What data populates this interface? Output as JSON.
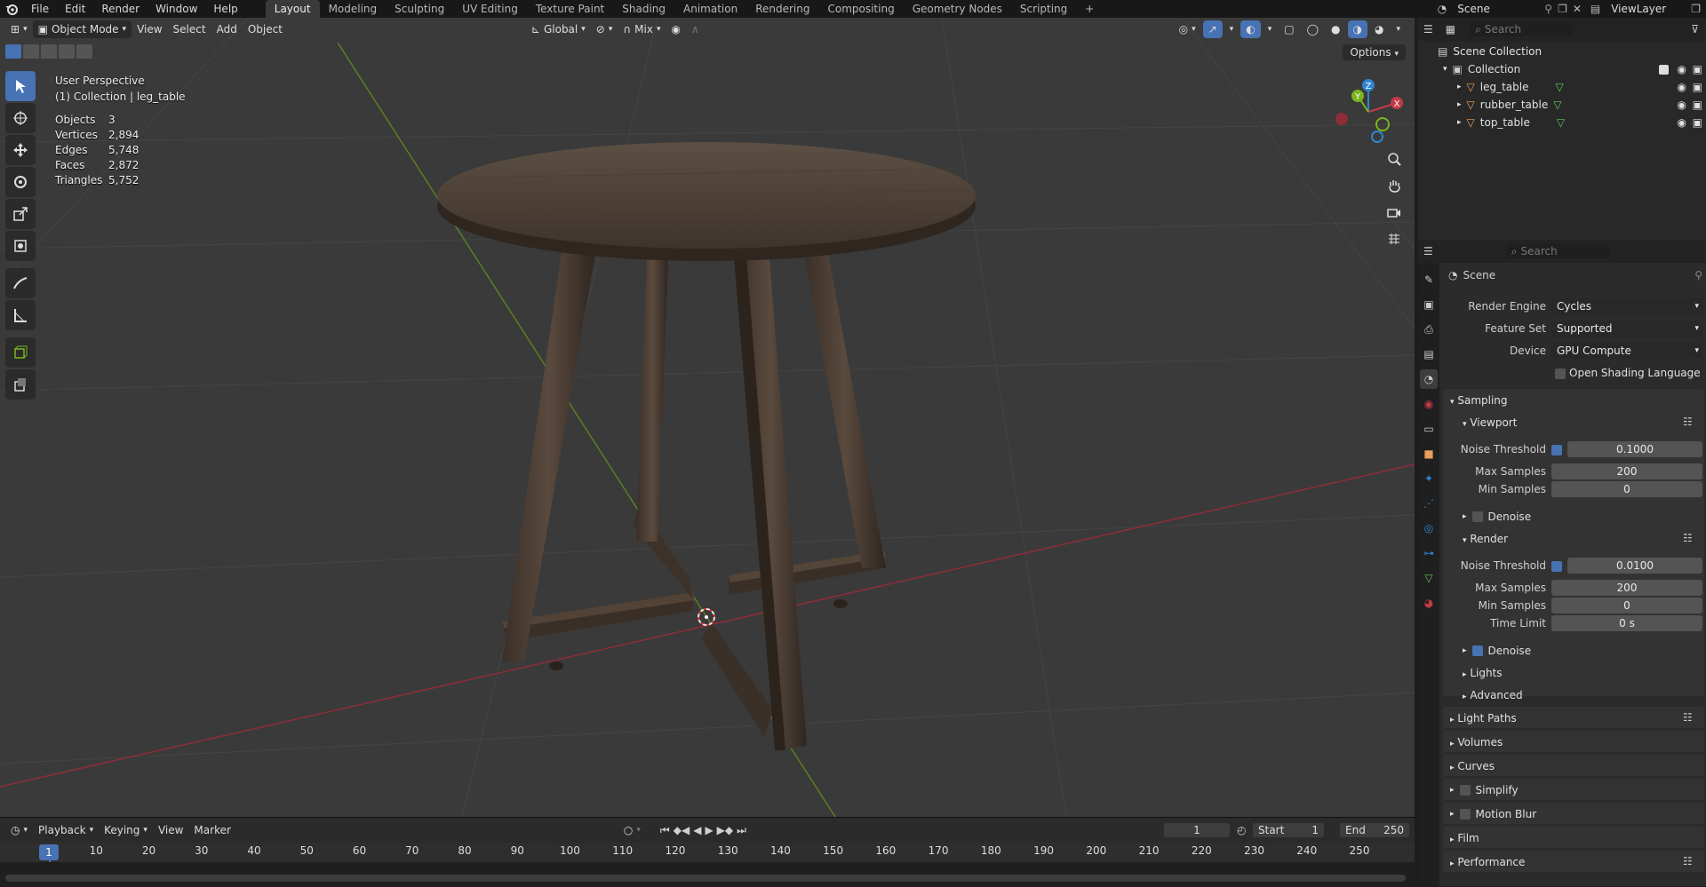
{
  "menu": {
    "items": [
      "File",
      "Edit",
      "Render",
      "Window",
      "Help"
    ]
  },
  "workspaces": [
    "Layout",
    "Modeling",
    "Sculpting",
    "UV Editing",
    "Texture Paint",
    "Shading",
    "Animation",
    "Rendering",
    "Compositing",
    "Geometry Nodes",
    "Scripting"
  ],
  "scene_name": "Scene",
  "view_layer": "ViewLayer",
  "viewport": {
    "mode": "Object Mode",
    "menus": [
      "View",
      "Select",
      "Add",
      "Object"
    ],
    "transform_orientation": "Global",
    "snap_mode": "Mix",
    "options_label": "Options",
    "perspective": "User Perspective",
    "active": "(1) Collection | leg_table",
    "stats": [
      {
        "label": "Objects",
        "value": "3"
      },
      {
        "label": "Vertices",
        "value": "2,894"
      },
      {
        "label": "Edges",
        "value": "5,748"
      },
      {
        "label": "Faces",
        "value": "2,872"
      },
      {
        "label": "Triangles",
        "value": "5,752"
      }
    ],
    "gizmo": {
      "z": "Z",
      "y": "Y",
      "x": "X"
    }
  },
  "timeline": {
    "menus": [
      "Playback",
      "Keying",
      "View",
      "Marker"
    ],
    "current_frame": "1",
    "start_label": "Start",
    "start": "1",
    "end_label": "End",
    "end": "250",
    "ticks": [
      "1",
      "10",
      "20",
      "30",
      "40",
      "50",
      "60",
      "70",
      "80",
      "90",
      "100",
      "110",
      "120",
      "130",
      "140",
      "150",
      "160",
      "170",
      "180",
      "190",
      "200",
      "210",
      "220",
      "230",
      "240",
      "250"
    ]
  },
  "outliner": {
    "search_placeholder": "Search",
    "scene_collection": "Scene Collection",
    "collection": "Collection",
    "objects": [
      "leg_table",
      "rubber_table",
      "top_table"
    ]
  },
  "properties": {
    "search_placeholder": "Search",
    "context": "Scene",
    "render_engine_label": "Render Engine",
    "render_engine": "Cycles",
    "feature_set_label": "Feature Set",
    "feature_set": "Supported",
    "device_label": "Device",
    "device": "GPU Compute",
    "osl_label": "Open Shading Language",
    "sampling": "Sampling",
    "viewport_label": "Viewport",
    "render_label": "Render",
    "noise_threshold_label": "Noise Threshold",
    "max_samples_label": "Max Samples",
    "min_samples_label": "Min Samples",
    "time_limit_label": "Time Limit",
    "denoise_label": "Denoise",
    "viewport_noise": "0.1000",
    "viewport_max": "200",
    "viewport_min": "0",
    "render_noise": "0.0100",
    "render_max": "200",
    "render_min": "0",
    "render_time": "0 s",
    "lights": "Lights",
    "advanced": "Advanced",
    "sections": [
      "Light Paths",
      "Volumes",
      "Curves",
      "Simplify",
      "Motion Blur",
      "Film",
      "Performance"
    ]
  },
  "colors": {
    "accent": "#4772b3",
    "x_axis": "#c13a46",
    "y_axis": "#7ab51d",
    "z_axis": "#2f84d0"
  }
}
